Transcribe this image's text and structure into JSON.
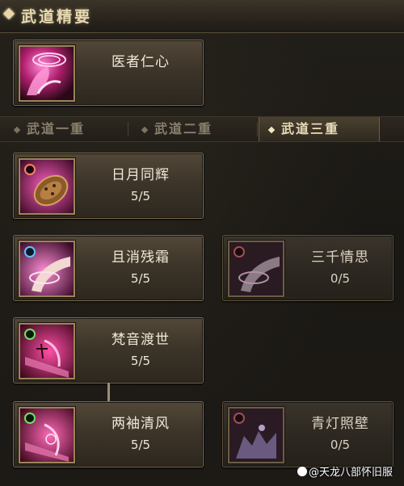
{
  "header": {
    "title": "武道精要"
  },
  "essence_skill": {
    "name": "医者仁心"
  },
  "tabs": [
    {
      "label": "武道一重",
      "active": false
    },
    {
      "label": "武道二重",
      "active": false
    },
    {
      "label": "武道三重",
      "active": true
    }
  ],
  "skills": [
    {
      "name": "日月同辉",
      "level": "5/5",
      "icon": "sun-moon-skill-icon"
    },
    {
      "name": "且消残霜",
      "level": "5/5",
      "icon": "frost-skill-icon"
    },
    {
      "name": "三千情思",
      "level": "0/5",
      "icon": "thought-skill-icon"
    },
    {
      "name": "梵音渡世",
      "level": "5/5",
      "icon": "chant-skill-icon"
    },
    {
      "name": "两袖清风",
      "level": "5/5",
      "icon": "breeze-skill-icon"
    },
    {
      "name": "青灯照壁",
      "level": "0/5",
      "icon": "lamp-skill-icon"
    }
  ],
  "watermark": {
    "text": "@天龙八部怀旧服"
  },
  "colors": {
    "gold_border": "#9a8659",
    "active_tab_text": "#e9dcba",
    "card_top": "#524839"
  }
}
